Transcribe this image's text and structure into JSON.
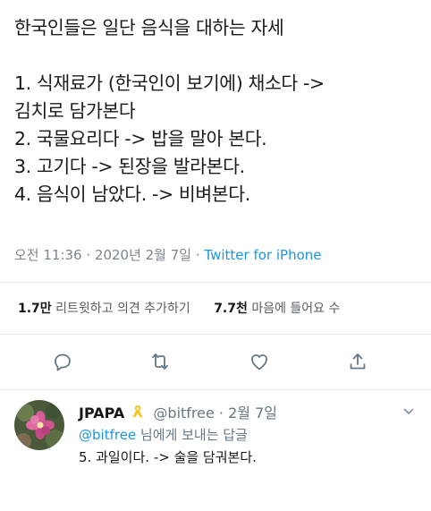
{
  "tweet": {
    "lines": [
      "한국인들은 일단 음식을 대하는 자세",
      "",
      "1. 식재료가 (한국인이 보기에) 채소다 ->",
      "김치로 담가본다",
      "2. 국물요리다 -> 밥을 말아 본다.",
      "3. 고기다 -> 된장을 발라본다.",
      "4. 음식이 남았다. -> 비벼본다."
    ],
    "timestamp": "오전 11:36 · 2020년 2월 7일",
    "separator": " · ",
    "source": "Twitter for iPhone"
  },
  "stats": {
    "retweets_count": "1.7만",
    "retweets_label": "리트윗하고 의견 추가하기",
    "likes_count": "7.7천",
    "likes_label": "마음에 들어요 수"
  },
  "actions": {
    "icons": [
      "reply-icon",
      "retweet-icon",
      "like-icon",
      "share-icon"
    ]
  },
  "reply": {
    "name": "JPAPA",
    "badge": "ribbon-icon",
    "handle": "@bitfree",
    "separator": " · ",
    "date": "2월 7일",
    "reply_to_mention": "@bitfree",
    "reply_to_suffix": " 님에게 보내는 답글",
    "text": "5. 과일이다. -> 술을 담궈본다."
  },
  "colors": {
    "link": "#1b95e0",
    "muted": "#657786",
    "divider": "#e6ecf0",
    "badge": "#f5c518"
  }
}
